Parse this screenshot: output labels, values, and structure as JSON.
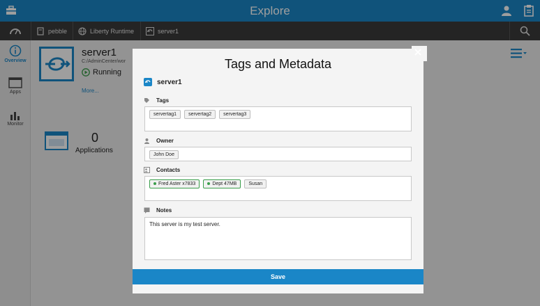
{
  "header": {
    "title": "Explore"
  },
  "breadcrumb": {
    "host": "pebble",
    "runtime": "Liberty Runtime",
    "server": "server1"
  },
  "sidebar": {
    "items": [
      {
        "label": "Overview"
      },
      {
        "label": "Apps"
      },
      {
        "label": "Monitor"
      }
    ]
  },
  "server": {
    "name": "server1",
    "path": "C:/AdminCenter/wor",
    "status": "Running",
    "more": "More..."
  },
  "apps": {
    "count": "0",
    "label": "Applications"
  },
  "dialog": {
    "title": "Tags and Metadata",
    "server": "server1",
    "tags": {
      "label": "Tags",
      "values": [
        "servertag1",
        "servertag2",
        "servertag3"
      ]
    },
    "owner": {
      "label": "Owner",
      "values": [
        "John Doe"
      ]
    },
    "contacts": {
      "label": "Contacts",
      "values": [
        "Fred Aster x7833",
        "Dept 47MB",
        "Susan"
      ]
    },
    "notes": {
      "label": "Notes",
      "value": "This server is my test server."
    },
    "save": "Save"
  },
  "colors": {
    "accent": "#1a86c7",
    "breadcrumb_bg": "#3a3a3a",
    "contact_green": "#3a9d4a"
  }
}
